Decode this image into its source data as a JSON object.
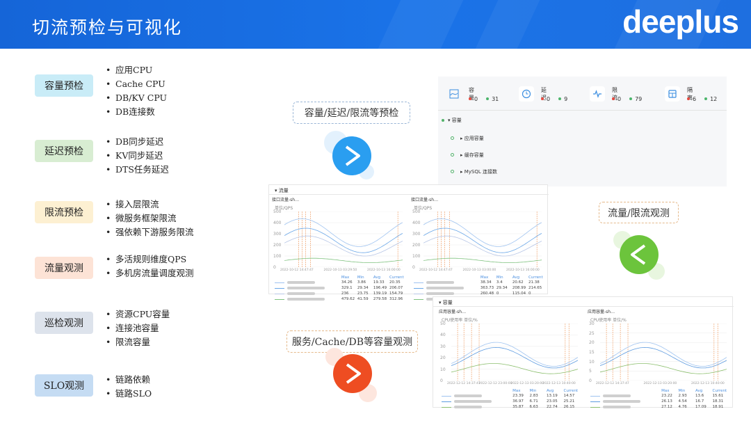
{
  "header": {
    "title": "切流预检与可视化",
    "logo": "deeplus",
    "bg_color": "#1a6fe3"
  },
  "categories": [
    {
      "label": "容量预检",
      "color": "#c9ecf7",
      "items": [
        "应用CPU",
        "Cache CPU",
        "DB/KV CPU",
        "DB连接数"
      ]
    },
    {
      "label": "延迟预检",
      "color": "#d8edd2",
      "items": [
        "DB同步延迟",
        "KV同步延迟",
        "DTS任务延迟"
      ]
    },
    {
      "label": "限流预检",
      "color": "#fdf0d2",
      "items": [
        "接入层限流",
        "微服务框架限流",
        "强依赖下游服务限流"
      ]
    },
    {
      "label": "流量观测",
      "color": "#fde3d6",
      "items": [
        "多活规则维度QPS",
        "多机房流量调度观测"
      ]
    },
    {
      "label": "巡检观测",
      "color": "#dde3ec",
      "items": [
        "资源CPU容量",
        "连接池容量",
        "限流容量"
      ]
    },
    {
      "label": "SLO观测",
      "color": "#c5dcf3",
      "items": [
        "链路依赖",
        "链路SLO"
      ]
    }
  ],
  "flow_labels": {
    "precheck": "容量/延迟/限流等预检",
    "traffic": "流量/限流观测",
    "capacity": "服务/Cache/DB等容量观测"
  },
  "arrow_colors": {
    "blue": "#2a9ef0",
    "green": "#6cc43c",
    "red": "#ee4d22"
  },
  "stats_panel": {
    "stats": [
      {
        "name": "容量",
        "red": "0",
        "green": "31",
        "icon": "chart-icon"
      },
      {
        "name": "延迟",
        "red": "0",
        "green": "9",
        "icon": "clock-icon"
      },
      {
        "name": "限流",
        "red": "0",
        "green": "79",
        "icon": "pulse-icon"
      },
      {
        "name": "隔离",
        "red": "6",
        "green": "12",
        "icon": "box-icon"
      }
    ],
    "tree_root": "▾ 容量",
    "tree_items": [
      "▸ 应用容量",
      "▸ 缓存容量",
      "▸ MySQL 连接数"
    ]
  },
  "traffic_panel": {
    "section": "▾ 流量",
    "charts": [
      {
        "title": "接口流量-sh…",
        "unit": "单位/QPS",
        "y_ticks": [
          "500",
          "400",
          "300",
          "200",
          "100",
          "0"
        ],
        "x_ticks": [
          "2022-10-12 14:47:47",
          "2022-10-13 03:29:50",
          "2022-10-13 16:00:00"
        ],
        "headers": [
          "Max",
          "Min",
          "Avg",
          "Current"
        ],
        "rows": [
          [
            "34.26",
            "3.86",
            "19.33",
            "20.35"
          ],
          [
            "329.1",
            "29.34",
            "196.49",
            "206.07"
          ],
          [
            "236",
            "23.75",
            "139.19",
            "154.79"
          ],
          [
            "479.62",
            "41.59",
            "279.58",
            "312.96"
          ]
        ]
      },
      {
        "title": "接口流量-sh…",
        "unit": "单位/QPS",
        "y_ticks": [
          "500",
          "400",
          "300",
          "200",
          "100",
          "0"
        ],
        "x_ticks": [
          "2022-10-12 14:47:47",
          "2022-10-13 03:00:00",
          "2022-10-13 16:00:00"
        ],
        "headers": [
          "Max",
          "Min",
          "Avg",
          "Current"
        ],
        "rows": [
          [
            "38.34",
            "3.4",
            "20.62",
            "21.38"
          ],
          [
            "363.73",
            "29.34",
            "208.99",
            "214.65"
          ],
          [
            "260.48",
            "0",
            "115.04",
            "0"
          ],
          [
            "527.49",
            "0",
            "234.46",
            "0"
          ]
        ]
      }
    ]
  },
  "capacity_panel": {
    "section": "▾ 容量",
    "charts": [
      {
        "title": "应用容量-sh…",
        "unit": "CPU使用率 单位/%",
        "y_ticks": [
          "50",
          "40",
          "30",
          "20",
          "10",
          "0"
        ],
        "x_ticks": [
          "2022-12-12 14:37:47",
          "2022-12-12 23:00:00",
          "2022-12-13 03:20:00",
          "2022-12-13 10:40:00"
        ],
        "headers": [
          "Max",
          "Min",
          "Avg",
          "Current"
        ],
        "rows": [
          [
            "23.39",
            "2.83",
            "13.19",
            "14.57"
          ],
          [
            "36.97",
            "6.71",
            "23.05",
            "25.21"
          ],
          [
            "35.87",
            "6.63",
            "22.74",
            "26.15"
          ]
        ]
      },
      {
        "title": "应用容量-sh…",
        "unit": "CPU使用率 单位/%",
        "y_ticks": [
          "30",
          "25",
          "20",
          "15",
          "10",
          "5",
          "0"
        ],
        "x_ticks": [
          "2022-12-12 14:37:47",
          "2022-12-13 03:20:00",
          "2022-12-13 10:40:00"
        ],
        "headers": [
          "Max",
          "Min",
          "Avg",
          "Current"
        ],
        "rows": [
          [
            "23.22",
            "2.93",
            "13.6",
            "15.61"
          ],
          [
            "26.13",
            "4.54",
            "16.7",
            "18.31"
          ],
          [
            "27.12",
            "4.76",
            "17.09",
            "18.91"
          ]
        ]
      }
    ]
  }
}
